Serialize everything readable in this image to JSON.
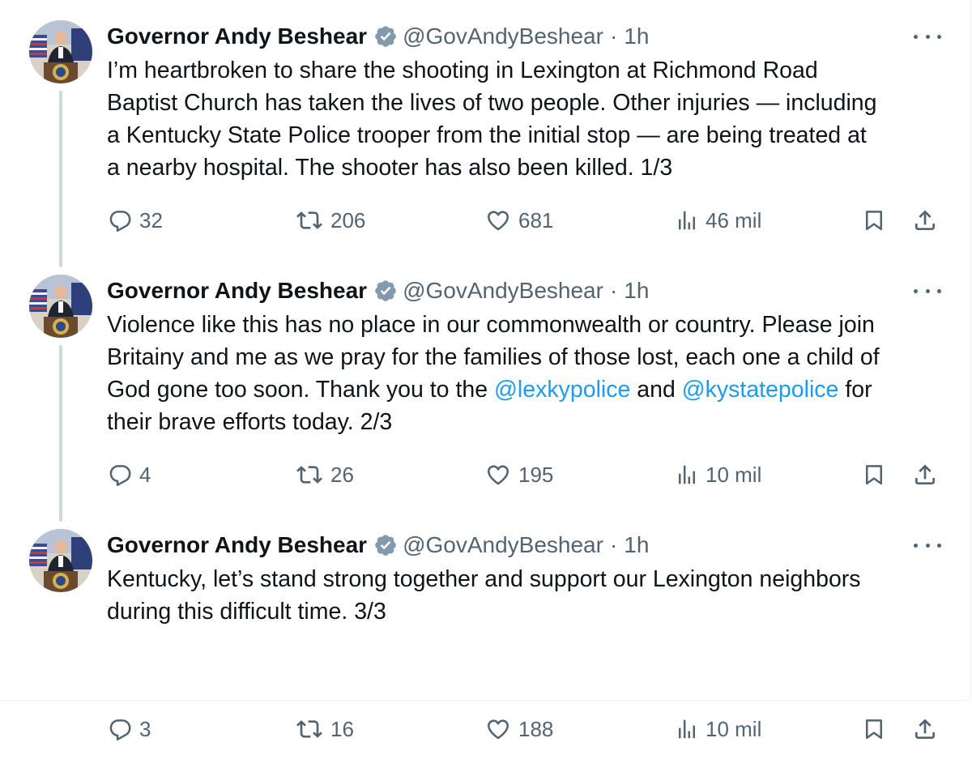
{
  "colors": {
    "text": "#0f1419",
    "secondary": "#536471",
    "mention": "#1d9bf0",
    "verified_badge": "#829aab",
    "thread_line": "#cfd9de"
  },
  "tweets": [
    {
      "author": {
        "name": "Governor Andy Beshear",
        "handle": "@GovAndyBeshear",
        "separator": "·",
        "time": "1h"
      },
      "lines": [
        [
          {
            "text": "I’m heartbroken to share the shooting in Lexington at Richmond Road"
          }
        ],
        [
          {
            "text": "Baptist Church has taken the lives of two people. Other injuries — including"
          }
        ],
        [
          {
            "text": "a Kentucky State Police trooper from the initial stop — are being treated at"
          }
        ],
        [
          {
            "text": "a nearby hospital. The shooter has also been killed. 1/3"
          }
        ]
      ],
      "stats": {
        "replies": "32",
        "reposts": "206",
        "likes": "681",
        "views": "46 mil"
      }
    },
    {
      "author": {
        "name": "Governor Andy Beshear",
        "handle": "@GovAndyBeshear",
        "separator": "·",
        "time": "1h"
      },
      "lines": [
        [
          {
            "text": "Violence like this has no place in our commonwealth or country. Please join"
          }
        ],
        [
          {
            "text": "Britainy and me as we pray for the families of those lost, each one a child of"
          }
        ],
        [
          {
            "text": "God gone too soon. Thank you to the "
          },
          {
            "text": "@lexkypolice",
            "mention": true
          },
          {
            "text": " and "
          },
          {
            "text": "@kystatepolice",
            "mention": true
          },
          {
            "text": " for"
          }
        ],
        [
          {
            "text": "their brave efforts today. 2/3"
          }
        ]
      ],
      "stats": {
        "replies": "4",
        "reposts": "26",
        "likes": "195",
        "views": "10 mil"
      }
    },
    {
      "author": {
        "name": "Governor Andy Beshear",
        "handle": "@GovAndyBeshear",
        "separator": "·",
        "time": "1h"
      },
      "lines": [
        [
          {
            "text": "Kentucky, let’s stand strong together and support our Lexington neighbors"
          }
        ],
        [
          {
            "text": "during this difficult time. 3/3"
          }
        ]
      ],
      "stats": {
        "replies": "3",
        "reposts": "16",
        "likes": "188",
        "views": "10 mil"
      }
    }
  ],
  "icons": {
    "reply": "reply-icon",
    "repost": "repost-icon",
    "like": "heart-icon",
    "views": "views-chart-icon",
    "bookmark": "bookmark-icon",
    "share": "share-icon",
    "more": "more-icon",
    "verified": "verified-badge-icon"
  }
}
